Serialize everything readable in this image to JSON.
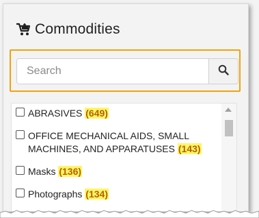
{
  "header": {
    "icon": "cart-icon",
    "title": "Commodities"
  },
  "search": {
    "placeholder": "Search",
    "value": "",
    "button_icon": "search-icon",
    "highlight_color": "#f0a30a"
  },
  "commodities": [
    {
      "label": "ABRASIVES",
      "count": "(649)",
      "checked": false
    },
    {
      "label": "OFFICE MECHANICAL AIDS, SMALL MACHINES, AND APPARATUSES",
      "count": "(143)",
      "checked": false
    },
    {
      "label": "Masks",
      "count": "(136)",
      "checked": false
    },
    {
      "label": "Photographs",
      "count": "(134)",
      "checked": false
    }
  ],
  "colors": {
    "count_highlight": "#fff566",
    "count_text": "#b36200"
  }
}
